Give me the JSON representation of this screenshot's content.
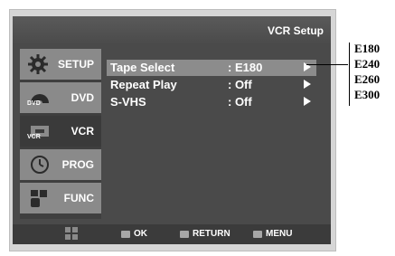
{
  "header": {
    "title": "VCR Setup"
  },
  "sidebar": {
    "items": [
      {
        "label": "SETUP",
        "icon": "gear-icon",
        "icon_text": ""
      },
      {
        "label": "DVD",
        "icon": "disc-icon",
        "icon_text": "DVD"
      },
      {
        "label": "VCR",
        "icon": "vcr-icon",
        "icon_text": "VCR",
        "selected": true
      },
      {
        "label": "PROG",
        "icon": "clock-icon",
        "icon_text": ""
      },
      {
        "label": "FUNC",
        "icon": "hand-icon",
        "icon_text": ""
      }
    ]
  },
  "menu": {
    "items": [
      {
        "name": "Tape Select",
        "value": ": E180",
        "highlighted": true
      },
      {
        "name": "Repeat Play",
        "value": ": Off",
        "highlighted": false
      },
      {
        "name": "S-VHS",
        "value": ": Off",
        "highlighted": false
      }
    ]
  },
  "footer": {
    "ok": "OK",
    "return": "RETURN",
    "menu": "MENU"
  },
  "callout": {
    "options": [
      "E180",
      "E240",
      "E260",
      "E300"
    ]
  }
}
